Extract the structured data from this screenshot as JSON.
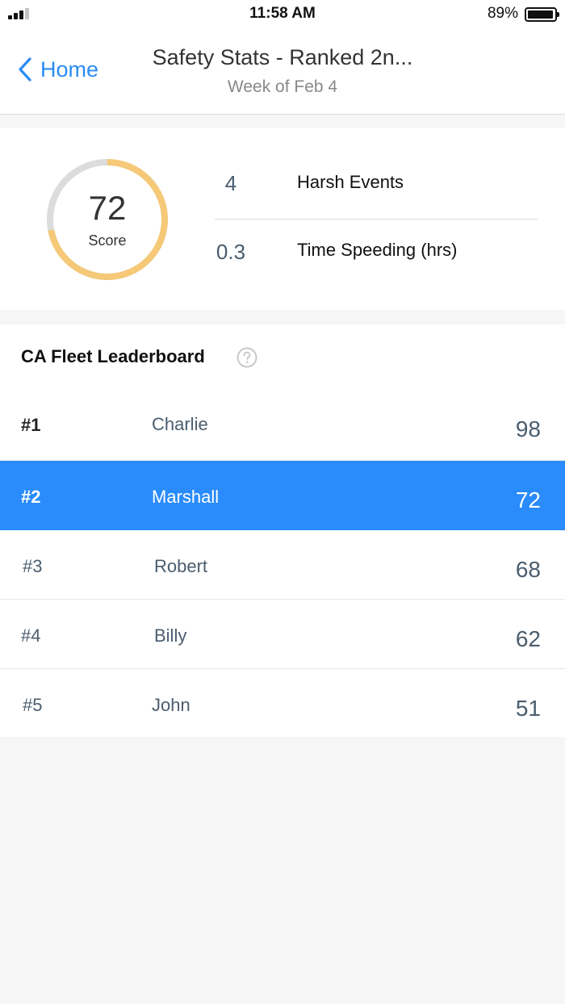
{
  "status_bar": {
    "time": "11:58 AM",
    "battery_percent": "89%",
    "battery_level": 0.89,
    "signal_bars_active": 3,
    "signal_bars_total": 4
  },
  "nav": {
    "back_label": "Home",
    "title": "Safety Stats - Ranked 2n...",
    "subtitle": "Week of Feb 4"
  },
  "score_card": {
    "score": "72",
    "score_label": "Score",
    "gauge_fraction": 0.72,
    "gauge_color": "#f5c978",
    "gauge_track_color": "#dcdcdc",
    "stats": [
      {
        "value": "4",
        "label": "Harsh Events"
      },
      {
        "value": "0.3",
        "label": "Time Speeding (hrs)"
      }
    ]
  },
  "leaderboard": {
    "title": "CA Fleet Leaderboard",
    "help_icon": "question-circle-icon",
    "highlight_color": "#2a8bfb",
    "rows": [
      {
        "rank": "#1",
        "name": "Charlie",
        "score": "98"
      },
      {
        "rank": "#2",
        "name": "Marshall",
        "score": "72"
      },
      {
        "rank": "#3",
        "name": "Robert",
        "score": "68"
      },
      {
        "rank": "#4",
        "name": "Billy",
        "score": "62"
      },
      {
        "rank": "#5",
        "name": "John",
        "score": "51"
      }
    ]
  }
}
